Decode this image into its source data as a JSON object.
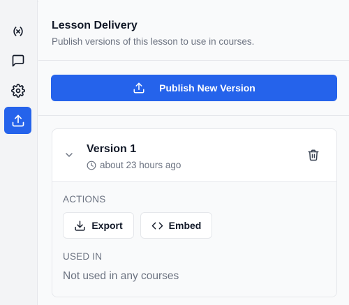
{
  "header": {
    "title": "Lesson Delivery",
    "subtitle": "Publish versions of this lesson to use in courses."
  },
  "sidebar": {
    "items": [
      {
        "icon": "variables-icon",
        "active": false
      },
      {
        "icon": "message-square-icon",
        "active": false
      },
      {
        "icon": "gear-icon",
        "active": false
      },
      {
        "icon": "upload-icon",
        "active": true
      }
    ]
  },
  "publish": {
    "label": "Publish New Version",
    "icon": "upload-icon"
  },
  "version": {
    "title": "Version 1",
    "time": "about 23 hours ago",
    "actions_label": "ACTIONS",
    "export_label": "Export",
    "embed_label": "Embed",
    "used_in_label": "USED IN",
    "used_in_value": "Not used in any courses"
  },
  "colors": {
    "accent": "#2563eb",
    "background": "#f9fafb",
    "border": "#e5e7eb",
    "muted_text": "#6b7280"
  }
}
